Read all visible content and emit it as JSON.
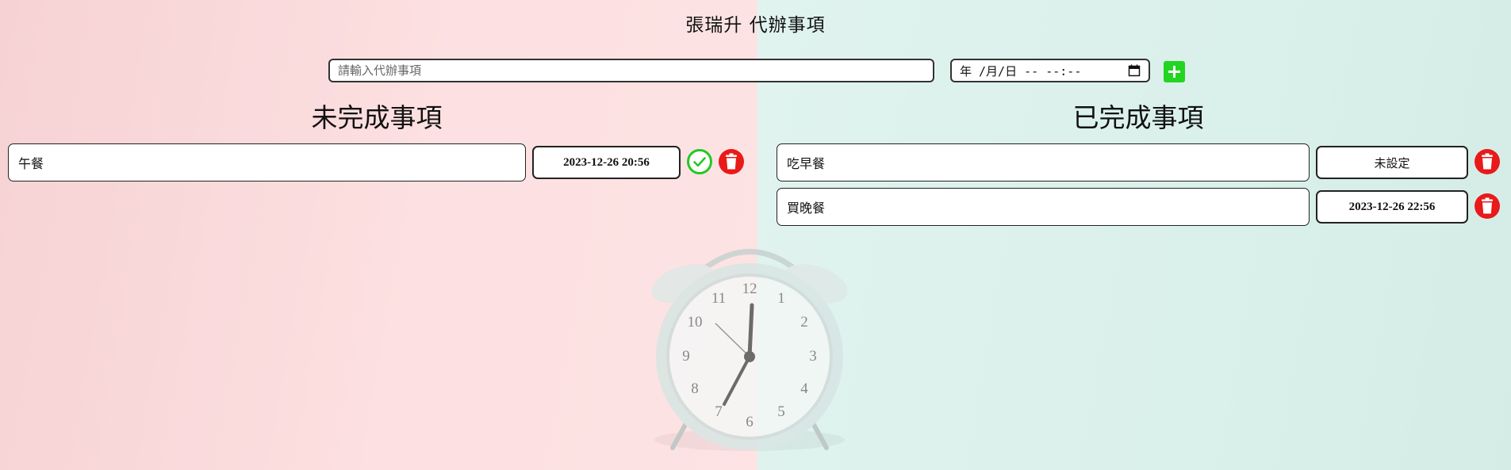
{
  "header": {
    "title": "張瑞升 代辦事項"
  },
  "form": {
    "todo_placeholder": "請輸入代辦事項",
    "date_display": "年 /月/日 -- --:--",
    "add_icon": "plus-icon"
  },
  "pending": {
    "heading": "未完成事項",
    "items": [
      {
        "text": "午餐",
        "time": "2023-12-26 20:56"
      }
    ]
  },
  "completed": {
    "heading": "已完成事項",
    "items": [
      {
        "text": "吃早餐",
        "time": "未設定"
      },
      {
        "text": "買晚餐",
        "time": "2023-12-26 22:56"
      }
    ]
  },
  "colors": {
    "left_bg": "#fde0e1",
    "right_bg": "#daf0ea",
    "check_green": "#22c922",
    "delete_red": "#e81a1a",
    "add_green": "#22d522"
  }
}
